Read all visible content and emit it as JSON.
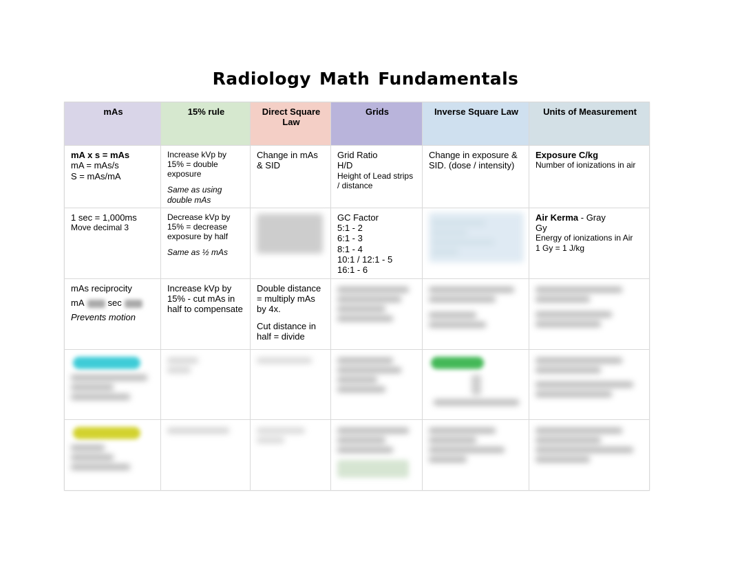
{
  "document": {
    "title": "Radiology Math Fundamentals"
  },
  "table": {
    "headers": [
      {
        "label": "mAs",
        "color": "#d9d5e8"
      },
      {
        "label": "15% rule",
        "color": "#d6e8cf"
      },
      {
        "label": "Direct Square Law",
        "color": "#f4cfc6"
      },
      {
        "label": "Grids",
        "color": "#b9b4db"
      },
      {
        "label": "Inverse Square Law",
        "color": "#cfe0ef"
      },
      {
        "label": "Units of Measurement",
        "color": "#d3e0e6"
      }
    ],
    "rows": [
      {
        "mas": {
          "l1": "mA x s = mAs",
          "l2": "mA = mAs/s",
          "l3": "S = mAs/mA"
        },
        "rule15": {
          "l1": "Increase kVp by 15% = double exposure",
          "l2": "Same as using double mAs"
        },
        "dsl": {
          "l1": "Change in mAs & SID"
        },
        "grids": {
          "l1": "Grid Ratio",
          "l2": "H/D",
          "l3": "Height of Lead strips / distance"
        },
        "isl": {
          "l1": "Change in exposure & SID. (dose / intensity)"
        },
        "units": {
          "l1": "Exposure C/kg",
          "l2": "Number of ionizations in air"
        }
      },
      {
        "mas": {
          "l1": "1 sec = 1,000ms",
          "l2": "Move decimal 3"
        },
        "rule15": {
          "l1": "Decrease kVp by 15% = decrease exposure by half",
          "l2": "Same as ½ mAs"
        },
        "dsl": {
          "redacted": true
        },
        "grids": {
          "l1": "GC Factor",
          "l2": "5:1 - 2",
          "l3": "6:1 - 3",
          "l4": "8:1 - 4",
          "l5": "10:1 / 12:1 - 5",
          "l6": "16:1 - 6"
        },
        "isl": {
          "redacted": true
        },
        "units": {
          "l1_bold": "Air Kerma",
          "l1_rest": " - Gray",
          "l2": "Gy",
          "l3": "Energy of ionizations in Air",
          "l4": "1 Gy = 1 J/kg"
        }
      },
      {
        "mas": {
          "l1": "mAs reciprocity",
          "l2_pre": "mA",
          "l2_mid": "sec",
          "l3": "Prevents motion"
        },
        "rule15": {
          "l1": "Increase kVp by 15% - cut mAs in half to compensate"
        },
        "dsl": {
          "l1": "Double distance = multiply mAs by 4x.",
          "l2": "Cut distance in half = divide"
        },
        "grids": {
          "redacted": true
        },
        "isl": {
          "redacted": true
        },
        "units": {
          "redacted": true
        }
      },
      {
        "mas": {
          "redacted": true,
          "highlight": "#2ec8d4"
        },
        "rule15": {
          "redacted": true
        },
        "dsl": {
          "redacted": true
        },
        "grids": {
          "redacted": true
        },
        "isl": {
          "redacted": true,
          "highlight": "#35b34a"
        },
        "units": {
          "redacted": true
        }
      },
      {
        "mas": {
          "redacted": true,
          "highlight": "#cfcf1e"
        },
        "rule15": {
          "redacted": true
        },
        "dsl": {
          "redacted": true
        },
        "grids": {
          "redacted": true,
          "tint": "#d3e3cf"
        },
        "isl": {
          "redacted": true
        },
        "units": {
          "redacted": true
        }
      }
    ]
  }
}
